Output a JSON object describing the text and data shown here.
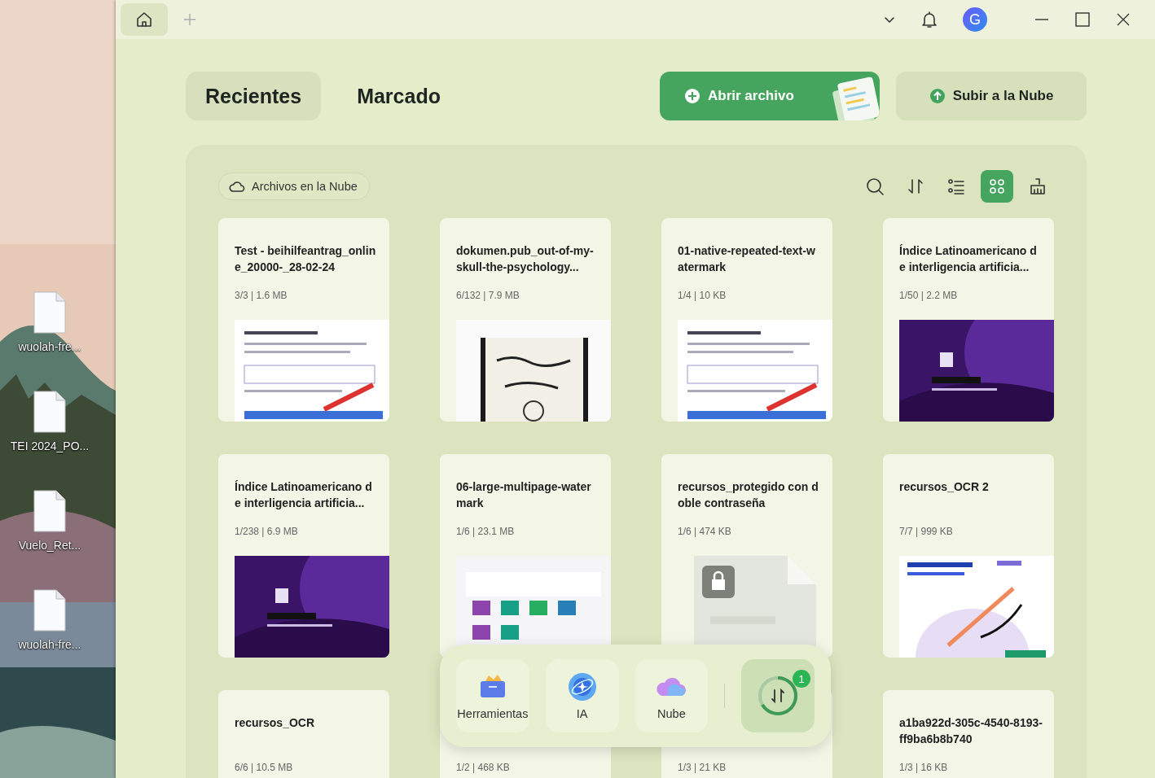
{
  "desktop": {
    "icons": [
      {
        "label": "wuolah-fre..."
      },
      {
        "label": "TEI 2024_PO..."
      },
      {
        "label": "Vuelo_Ret..."
      },
      {
        "label": "wuolah-fre..."
      }
    ]
  },
  "title_bar": {
    "tabs": [
      {
        "kind": "home",
        "selected": true
      }
    ],
    "avatar": "G"
  },
  "nav_tabs": [
    {
      "label": "Recientes",
      "selected": true
    },
    {
      "label": "Marcado",
      "selected": false
    }
  ],
  "actions": [
    {
      "kind": "primary",
      "label": "Abrir archivo"
    },
    {
      "kind": "secondary",
      "label": "Subir a la Nube"
    }
  ],
  "filter": {
    "label": "Archivos en la Nube"
  },
  "view_tools": [
    {
      "kind": "search",
      "selected": false
    },
    {
      "kind": "sort",
      "selected": false
    },
    {
      "kind": "list",
      "selected": false
    },
    {
      "kind": "grid",
      "selected": true
    },
    {
      "kind": "clean",
      "selected": false
    }
  ],
  "files": [
    {
      "title": "Test - beihilfeantrag_online_20000-_28-02-24",
      "meta": "3/3 | 1.6 MB"
    },
    {
      "title": "dokumen.pub_out-of-my-skull-the-psychology...",
      "meta": "6/132 | 7.9 MB"
    },
    {
      "title": "01-native-repeated-text-watermark",
      "meta": "1/4 | 10 KB"
    },
    {
      "title": "Índice Latinoamericano de interligencia artificia...",
      "meta": "1/50 | 2.2 MB"
    },
    {
      "title": "Índice Latinoamericano de interligencia artificia...",
      "meta": "1/238 | 6.9 MB"
    },
    {
      "title": "06-large-multipage-watermark",
      "meta": "1/6 | 23.1 MB"
    },
    {
      "title": "recursos_protegido  con doble contraseña",
      "meta": "1/6 | 474 KB",
      "thumb": {
        "kind": "locked"
      }
    },
    {
      "title": "recursos_OCR 2",
      "meta": "7/7 | 999 KB"
    },
    {
      "title": "recursos_OCR",
      "meta": "6/6 | 10.5 MB"
    },
    {
      "meta": "1/2 | 468 KB"
    },
    {
      "meta": "1/3 | 21 KB"
    },
    {
      "title": "a1ba922d-305c-4540-8193-ff9ba6b8b740",
      "meta": "1/3 | 16 KB"
    }
  ],
  "dock": {
    "items": [
      {
        "kind": "tools",
        "label": "Herramientas"
      },
      {
        "kind": "ai",
        "label": "IA"
      },
      {
        "kind": "cloud",
        "label": "Nube"
      }
    ],
    "sync": {
      "badge": "1"
    }
  }
}
